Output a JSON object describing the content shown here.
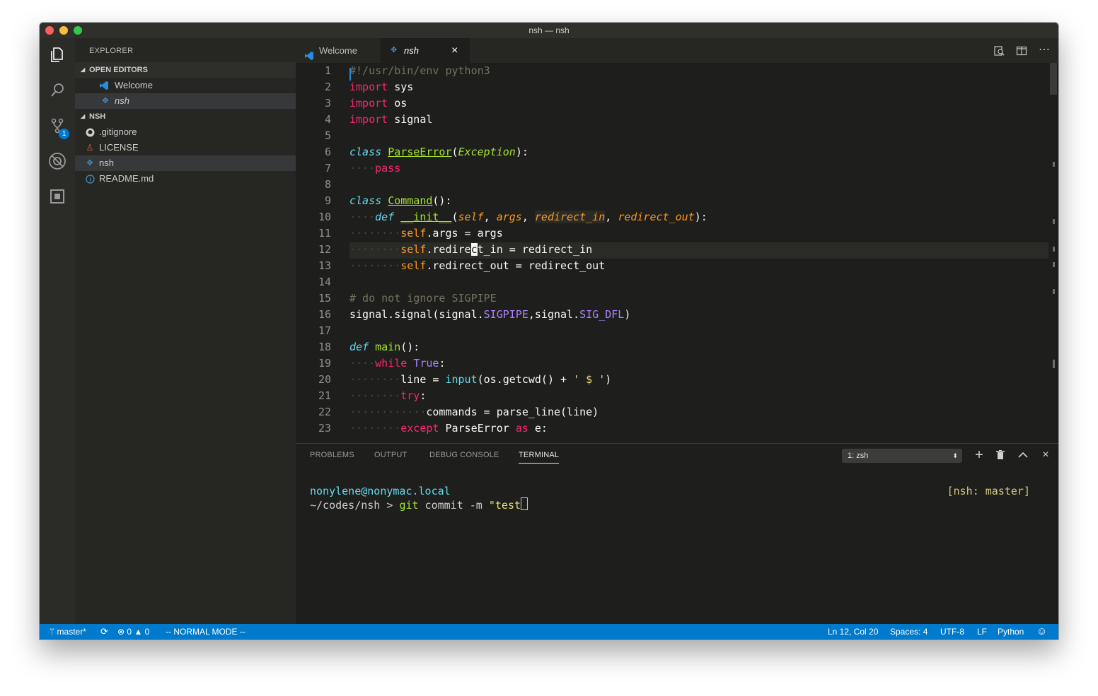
{
  "window": {
    "title": "nsh — nsh"
  },
  "activity_bar": {
    "scm_badge": "1"
  },
  "sidebar": {
    "title": "EXPLORER",
    "open_editors_label": "OPEN EDITORS",
    "open_editors": [
      {
        "label": "Welcome",
        "icon": "vscode-icon"
      },
      {
        "label": "nsh",
        "icon": "python-icon"
      }
    ],
    "folder_label": "NSH",
    "files": [
      {
        "label": ".gitignore",
        "icon": "github-icon"
      },
      {
        "label": "LICENSE",
        "icon": "license-icon"
      },
      {
        "label": "nsh",
        "icon": "python-icon"
      },
      {
        "label": "README.md",
        "icon": "info-icon"
      }
    ]
  },
  "tabs": [
    {
      "label": "Welcome"
    },
    {
      "label": "nsh",
      "close": "×"
    }
  ],
  "code": {
    "line_numbers": [
      "1",
      "2",
      "3",
      "4",
      "5",
      "6",
      "7",
      "8",
      "9",
      "10",
      "11",
      "12",
      "13",
      "14",
      "15",
      "16",
      "17",
      "18",
      "19",
      "20",
      "21",
      "22",
      "23"
    ],
    "l1": "#!/usr/bin/env python3",
    "kw_import": "import",
    "sys": "sys",
    "os": "os",
    "signal": "signal",
    "kw_class": "class",
    "ParseError": "ParseError",
    "Exception": "Exception",
    "pass": "pass",
    "Command": "Command",
    "kw_def": "def",
    "init": "__init__",
    "self": "self",
    "args": "args",
    "redirect_in": "redirect_in",
    "redirect_out": "redirect_out",
    "l11_rest": ".args = args",
    "l12_a": ".redire",
    "l12_cursor": "c",
    "l12_b": "t_in = redirect_in",
    "l13_rest": ".redirect_out = redirect_out",
    "l15": "# do not ignore SIGPIPE",
    "l16_a": "signal.signal(signal.",
    "SIGPIPE": "SIGPIPE",
    "l16_b": ",signal.",
    "SIG_DFL": "SIG_DFL",
    "l16_c": ")",
    "main": "main",
    "kw_while": "while",
    "True": "True",
    "l20_a": "line = ",
    "input": "input",
    "l20_b": "(os.getcwd() + ",
    "l20_str": "' $ '",
    "l20_c": ")",
    "kw_try": "try",
    "l22": "commands = parse_line(line)",
    "kw_except": "except",
    "l23_a": " ParseError ",
    "kw_as": "as",
    "l23_b": " e:"
  },
  "panel": {
    "tabs": [
      "PROBLEMS",
      "OUTPUT",
      "DEBUG CONSOLE",
      "TERMINAL"
    ],
    "terminal_select": "1: zsh",
    "prompt_host": "nonylene@nonymac.local",
    "prompt_path": "~/codes/nsh > ",
    "cmd_git": "git",
    "cmd_rest": " commit -m ",
    "cmd_str": "\"test",
    "right_status": "[nsh: master]"
  },
  "status": {
    "branch": "master*",
    "errors": "0",
    "warnings": "0",
    "mode": "-- NORMAL MODE --",
    "position": "Ln 12, Col 20",
    "spaces": "Spaces: 4",
    "encoding": "UTF-8",
    "eol": "LF",
    "language": "Python"
  },
  "colors": {
    "statusbar": "#007acc",
    "keyword": "#f92672",
    "storage": "#66d9ef",
    "function": "#a6e22e",
    "parameter": "#fd971f",
    "comment": "#75715e",
    "constant": "#ae81ff"
  }
}
